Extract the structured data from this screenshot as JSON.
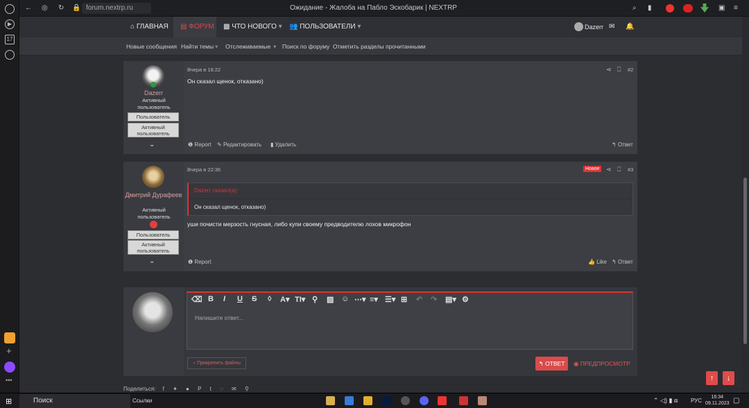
{
  "browser": {
    "url": "forum.nextrp.ru",
    "title": "Ожидание - Жалоба на Пабло Эскобарик | NEXTRP"
  },
  "nav": {
    "home": "ГЛАВНАЯ",
    "forums": "ФОРУМ",
    "whats_new": "ЧТО НОВОГО",
    "users": "ПОЛЬЗОВАТЕЛИ",
    "username": "Dazerr"
  },
  "subnav": [
    "Новые сообщения",
    "Найти темы",
    "Отслеживаемые",
    "Поиск по форуму",
    "Отметить разделы прочитанными"
  ],
  "posts": [
    {
      "author": "Dazerr",
      "title": "Активный пользователь",
      "badges": [
        "Пользователь",
        "Активный пользователь"
      ],
      "time": "Вчера в 16:22",
      "number": "#2",
      "text": "Он сказал щенок, отказано)",
      "actions": {
        "report": "Report",
        "edit": "Редактировать",
        "delete": "Удалить",
        "reply": "Ответ"
      }
    },
    {
      "author": "Дмитрий Дурафеев",
      "title": "Активный пользователь",
      "badges": [
        "Пользователь",
        "Активный пользователь"
      ],
      "time": "Вчера в 22:36",
      "number": "#3",
      "new_label": "Новое",
      "quote_author": "Dazerr сказал(а):",
      "quote_text": "Он сказал щенок, отказано)",
      "text": "уши почисти мерзость гнусная, либо купи своему предводителю лохов микрофон",
      "actions": {
        "report": "Report",
        "like": "Like",
        "reply": "Ответ"
      }
    }
  ],
  "editor": {
    "placeholder": "Напишите ответ...",
    "attach": "Прикрепить файлы",
    "reply": "ОТВЕТ",
    "preview": "ПРЕДПРОСМОТР"
  },
  "share_label": "Поделиться:",
  "taskbar": {
    "search": "Поиск",
    "links": "Ссылки",
    "lang": "РУС",
    "time": "16:34",
    "date": "09.11.2023"
  },
  "colors": {
    "accent": "#d94b4b",
    "bg": "#2c2d31",
    "post_bg": "#3d3e43"
  }
}
